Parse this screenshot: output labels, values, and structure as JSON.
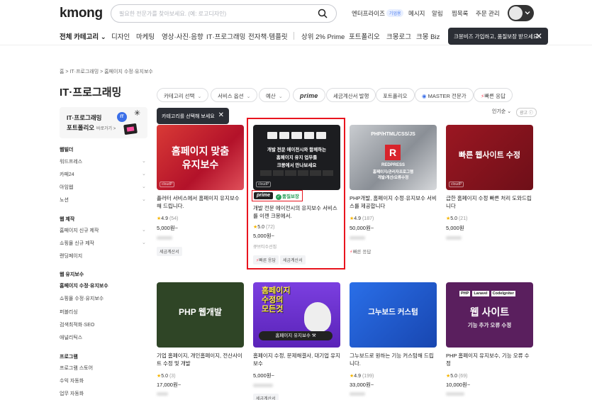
{
  "header": {
    "logo": "kmong",
    "search_placeholder": "필요한 전문가를 찾아보세요. (예: 로고디자인)",
    "nav": {
      "enterprise": "엔터프라이즈",
      "beta": "기업용",
      "messages": "메시지",
      "alerts": "알림",
      "favorites": "찜목록",
      "orders": "주문 관리"
    }
  },
  "category_nav": {
    "all": "전체 카테고리",
    "items": [
      "디자인",
      "마케팅",
      "영상·사진·음향",
      "IT·프로그래밍",
      "전자책·템플릿"
    ],
    "extra": [
      "상위 2% Prime",
      "포트폴리오",
      "크몽로그",
      "크몽 Biz"
    ],
    "tooltip": "크몽비즈 가입하고, 품질보장 받으세요."
  },
  "breadcrumb": "홈 > IT·프로그래밍 > 홈페이지 수정·유지보수",
  "page_title": "IT·프로그래밍",
  "filters": {
    "category_select": "카테고리 선택",
    "service_options": "서비스 옵션",
    "budget": "예산",
    "prime": "prime",
    "tax_invoice": "세금계산서 발행",
    "portfolio": "포트폴리오",
    "master": "MASTER 전문가",
    "fast": "빠른 응답",
    "category_tip": "카테고리를 선택해 보세요",
    "sort": "인기순",
    "ad": "광고"
  },
  "promo": {
    "line1": "IT·프로그래밍",
    "line2": "포트폴리오",
    "line3": "바로가기 >",
    "badge": "IT"
  },
  "sidebar": {
    "groups": [
      {
        "heading": "웹빌더",
        "items": [
          "워드프레스",
          "카페24",
          "아임웹",
          "노션"
        ]
      },
      {
        "heading": "웹 제작",
        "items": [
          "홈페이지 신규 제작",
          "쇼핑몰 신규 제작",
          "랜딩페이지"
        ]
      },
      {
        "heading": "웹 유지보수",
        "items": [
          "홈페이지 수정·유지보수",
          "쇼핑몰 수정·유지보수",
          "퍼블리싱",
          "검색최적화·SEO",
          "애널리틱스"
        ]
      },
      {
        "heading": "프로그램",
        "items": [
          "프로그램 스토어",
          "수익 자동화",
          "업무 자동화"
        ]
      }
    ]
  },
  "cards": [
    {
      "thumb_text": "홈페이지 맞춤\n유지보수",
      "title": "플러터 서비스에서 홈페이지 유지보수 해 드립니다.",
      "rating": "4.9",
      "count": "(54)",
      "price": "5,000원~",
      "tags": [
        "세금계산서"
      ]
    },
    {
      "thumb_text": "개발 전문 에이전시와 함께하는\n홈페이지 유지 업무를\n크몽에서 만나보세요",
      "prime": "prime",
      "quality": "품질보장",
      "title": "개발 전문 에이전시의 유지보수 서비스를 이젠 크몽에서.",
      "rating": "5.0",
      "count": "(72)",
      "price": "5,000원~",
      "seller": "큐브티수선집",
      "tags": [
        "빠른 응답",
        "세금계산서"
      ]
    },
    {
      "thumb_text": "PHP/HTML/CSS/JS",
      "thumb_sub": "REDPRESS",
      "thumb_sub2": "홈페이지/관리자프로그램\n개발/개선/오류수정",
      "title": "PHP개발, 홈페이지 수정·유지보수 서비스를 제공합니다",
      "rating": "4.9",
      "count": "(187)",
      "price": "50,000원~",
      "tags": [
        "빠른 응답"
      ]
    },
    {
      "thumb_text": "빠른 웹사이트 수정",
      "title": "급한 홈페이지 수정 빠른 처리 도와드립니다",
      "rating": "5.0",
      "count": "(21)",
      "price": "5,000원"
    },
    {
      "thumb_text": "PHP 웹개발",
      "title": "기업 홈페이지, 개인홈페이지, 전산사이트 수정 및 개발",
      "rating": "5.0",
      "count": "(3)",
      "price": "17,000원~"
    },
    {
      "thumb_text": "홈페이지\n수정의\n모든것",
      "thumb_sub": "홈페이지 유지보수",
      "title": "홈페이지 수정, 문제해결사, 대기업 유지보수",
      "price": "5,000원~",
      "tags": [
        "세금계산서"
      ]
    },
    {
      "thumb_text": "그누보드 커스텀",
      "title": "그누보드로 원하는 기능 커스텀해 드립니다.",
      "rating": "4.9",
      "count": "(199)",
      "price": "33,000원~"
    },
    {
      "thumb_text": "웹 사이트",
      "thumb_sub": "기능 추가 오류 수정",
      "chips": [
        "PHP",
        "Laravel",
        "CodeIgniter"
      ],
      "title": "PHP 홈페이지 유지보수, 기능 오류 수정",
      "rating": "5.0",
      "count": "(69)",
      "price": "10,000원~"
    }
  ],
  "colors": {
    "highlight": "#e8141e",
    "star": "#f5b400",
    "quality": "#27a05a",
    "bolt": "#ff3b50"
  }
}
